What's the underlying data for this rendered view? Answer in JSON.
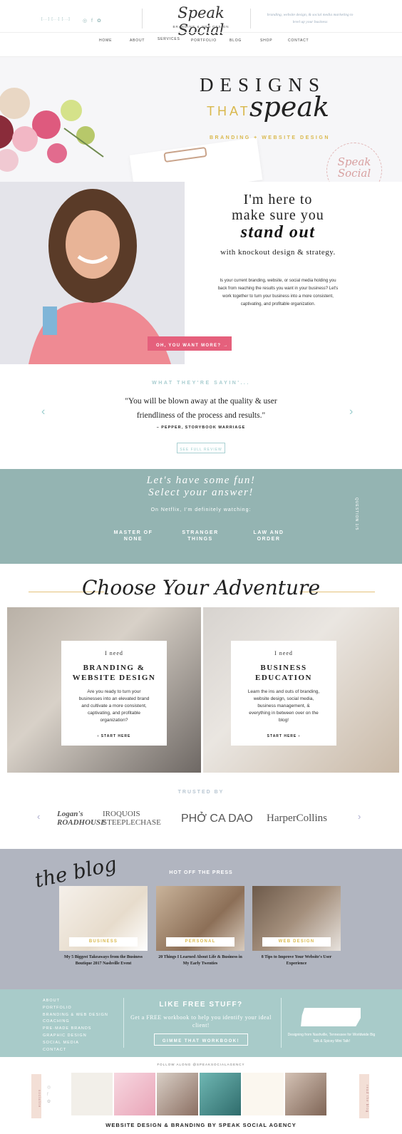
{
  "header": {
    "phone": "[...] [...] [...]",
    "social_icons": "◎ f ✿",
    "logo_script": "Speak Social",
    "logo_sub": "BRANDING & WEB DESIGN",
    "tagline": "branding, website design, & social media marketing to level up your business"
  },
  "nav": [
    "HOME",
    "ABOUT",
    "SERVICES",
    "PORTFOLIO",
    "BLOG",
    "SHOP",
    "CONTACT"
  ],
  "hero": {
    "designs": "DESIGNS",
    "that": "THAT",
    "speak": "speak",
    "brandline": "BRANDING + WEBSITE DESIGN",
    "stamp": "Speak Social"
  },
  "intro": {
    "h1_line1": "I'm here to",
    "h1_line2": "make sure you",
    "h2": "stand out",
    "h3": "with knockout design & strategy.",
    "p": "Is your current branding, website, or social media holding you back from reaching the results you want in your business? Let's work together to turn your business into a more consistent, captivating, and profitable organization.",
    "cta": "OH, YOU WANT MORE? →"
  },
  "testimonial": {
    "title": "WHAT THEY'RE SAYIN'...",
    "quote": "\"You will be blown away at the quality & user friendliness of the process and results.\"",
    "author": "– PEPPER, STORYBOOK MARRIAGE",
    "button": "SEE FULL REVIEW",
    "prev": "‹",
    "next": "›"
  },
  "quiz": {
    "heading1": "Let's have some fun!",
    "heading2": "Select your answer!",
    "sub": "On Netflix, I'm definitely watching:",
    "options": [
      "MASTER OF NONE",
      "STRANGER THINGS",
      "LAW AND ORDER"
    ],
    "side": "QUESTION 1/5"
  },
  "adventure": {
    "title": "Choose Your Adventure",
    "cards": [
      {
        "need": "I need",
        "title": "BRANDING & WEBSITE DESIGN",
        "text": "Are you ready to turn your businesses into an elevated brand and cultivate a more consistent, captivating, and profitable organization?",
        "link": "‹  START HERE"
      },
      {
        "need": "I need",
        "title": "BUSINESS EDUCATION",
        "text": "Learn the ins and outs of branding, website design, social media, business management, & everything in between over on the blog!",
        "link": "START HERE  ›"
      }
    ]
  },
  "trusted": {
    "title": "TRUSTED BY",
    "logos": [
      "Logan's ROADHOUSE",
      "IROQUOIS STEEPLECHASE",
      "PHỞ CA DAO",
      "HarperCollins"
    ]
  },
  "blog": {
    "script": "the blog",
    "heading": "HOT OFF THE PRESS",
    "posts": [
      {
        "cat": "BUSINESS",
        "title": "My 5 Biggest Takeaways from the Business Boutique 2017 Nashville Event"
      },
      {
        "cat": "PERSONAL",
        "title": "20 Things I Learned About Life & Business in My Early Twenties"
      },
      {
        "cat": "WEB DESIGN",
        "title": "8 Tips to Improve Your Website's User Experience"
      }
    ]
  },
  "footer": {
    "links": [
      "ABOUT",
      "PORTFOLIO",
      "BRANDING & WEB DESIGN",
      "COACHING",
      "PRE-MADE BRANDS",
      "GRAPHIC DESIGN",
      "SOCIAL MEDIA",
      "CONTACT"
    ],
    "free_heading": "LIKE FREE STUFF?",
    "free_text": "Get a FREE workbook to help you identify your ideal client!",
    "free_button": "GIMME THAT WORKBOOK!",
    "tn_text": "Designing from Nashville, Tennessee for Worldwide Big Talk & Spicey Mini Talk!",
    "follow": "FOLLOW ALONG   @SPEAKSOCIALAGENCY",
    "side_left": "socialite",
    "side_right": "read the blog",
    "credit": "WEBSITE DESIGN & BRANDING BY SPEAK SOCIAL AGENCY"
  },
  "colors": {
    "teal": "#94b4b2",
    "pink": "#e5607c",
    "gold": "#d9b84c",
    "slate": "#b1b5c0",
    "mint": "#a8cbc9"
  }
}
